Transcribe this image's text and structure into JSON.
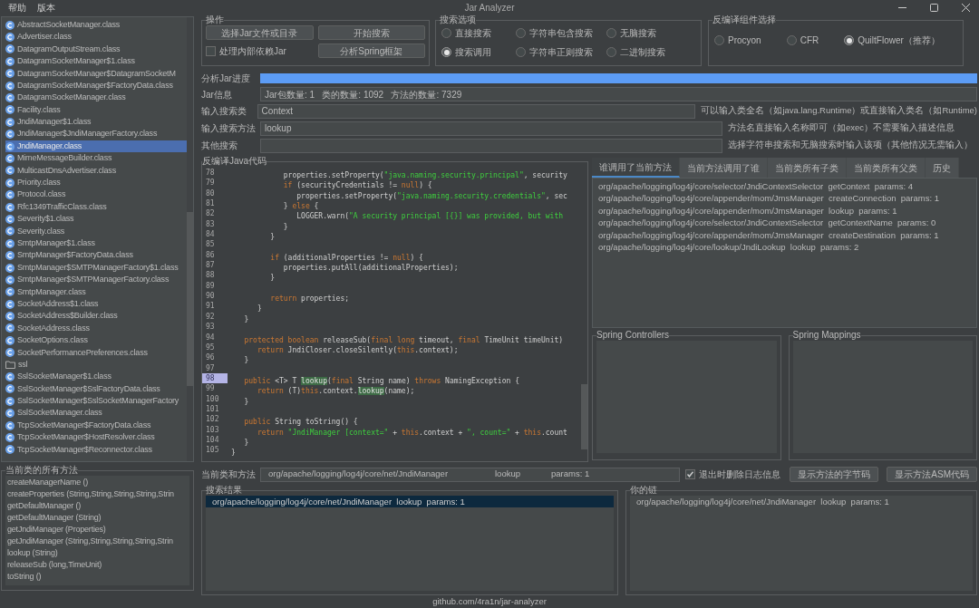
{
  "window": {
    "title": "Jar Analyzer",
    "menu": [
      "帮助",
      "版本"
    ]
  },
  "tree": {
    "items": [
      {
        "label": "AbstractSocketManager.class",
        "kind": "class",
        "selected": false
      },
      {
        "label": "Advertiser.class",
        "kind": "class",
        "selected": false
      },
      {
        "label": "DatagramOutputStream.class",
        "kind": "class",
        "selected": false
      },
      {
        "label": "DatagramSocketManager$1.class",
        "kind": "class",
        "selected": false
      },
      {
        "label": "DatagramSocketManager$DatagramSocketM",
        "kind": "class",
        "selected": false
      },
      {
        "label": "DatagramSocketManager$FactoryData.class",
        "kind": "class",
        "selected": false
      },
      {
        "label": "DatagramSocketManager.class",
        "kind": "class",
        "selected": false
      },
      {
        "label": "Facility.class",
        "kind": "class",
        "selected": false
      },
      {
        "label": "JndiManager$1.class",
        "kind": "class",
        "selected": false
      },
      {
        "label": "JndiManager$JndiManagerFactory.class",
        "kind": "class",
        "selected": false
      },
      {
        "label": "JndiManager.class",
        "kind": "class",
        "selected": true
      },
      {
        "label": "MimeMessageBuilder.class",
        "kind": "class",
        "selected": false
      },
      {
        "label": "MulticastDnsAdvertiser.class",
        "kind": "class",
        "selected": false
      },
      {
        "label": "Priority.class",
        "kind": "class",
        "selected": false
      },
      {
        "label": "Protocol.class",
        "kind": "class",
        "selected": false
      },
      {
        "label": "Rfc1349TrafficClass.class",
        "kind": "class",
        "selected": false
      },
      {
        "label": "Severity$1.class",
        "kind": "class",
        "selected": false
      },
      {
        "label": "Severity.class",
        "kind": "class",
        "selected": false
      },
      {
        "label": "SmtpManager$1.class",
        "kind": "class",
        "selected": false
      },
      {
        "label": "SmtpManager$FactoryData.class",
        "kind": "class",
        "selected": false
      },
      {
        "label": "SmtpManager$SMTPManagerFactory$1.class",
        "kind": "class",
        "selected": false
      },
      {
        "label": "SmtpManager$SMTPManagerFactory.class",
        "kind": "class",
        "selected": false
      },
      {
        "label": "SmtpManager.class",
        "kind": "class",
        "selected": false
      },
      {
        "label": "SocketAddress$1.class",
        "kind": "class",
        "selected": false
      },
      {
        "label": "SocketAddress$Builder.class",
        "kind": "class",
        "selected": false
      },
      {
        "label": "SocketAddress.class",
        "kind": "class",
        "selected": false
      },
      {
        "label": "SocketOptions.class",
        "kind": "class",
        "selected": false
      },
      {
        "label": "SocketPerformancePreferences.class",
        "kind": "class",
        "selected": false
      },
      {
        "label": "ssl",
        "kind": "folder",
        "selected": false
      },
      {
        "label": "SslSocketManager$1.class",
        "kind": "class",
        "selected": false
      },
      {
        "label": "SslSocketManager$SslFactoryData.class",
        "kind": "class",
        "selected": false
      },
      {
        "label": "SslSocketManager$SslSocketManagerFactory",
        "kind": "class",
        "selected": false
      },
      {
        "label": "SslSocketManager.class",
        "kind": "class",
        "selected": false
      },
      {
        "label": "TcpSocketManager$FactoryData.class",
        "kind": "class",
        "selected": false
      },
      {
        "label": "TcpSocketManager$HostResolver.class",
        "kind": "class",
        "selected": false
      },
      {
        "label": "TcpSocketManager$Reconnector.class",
        "kind": "class",
        "selected": false
      }
    ]
  },
  "methods": {
    "title": "当前类的所有方法",
    "items": [
      "createManagerName ()",
      "createProperties (String,String,String,String,Strin",
      "getDefaultManager ()",
      "getDefaultManager (String)",
      "getJndiManager (Properties)",
      "getJndiManager (String,String,String,String,Strin",
      "lookup (String)",
      "releaseSub (long,TimeUnit)",
      "toString ()"
    ]
  },
  "operations": {
    "title": "操作",
    "buttons": [
      "选择Jar文件或目录",
      "开始搜索",
      "分析Spring框架"
    ],
    "checkbox": {
      "label": "处理内部依赖Jar",
      "checked": false
    }
  },
  "search_options": {
    "title": "搜索选项",
    "options": [
      {
        "label": "直接搜索",
        "selected": false
      },
      {
        "label": "字符串包含搜索",
        "selected": false
      },
      {
        "label": "无脑搜索",
        "selected": false
      },
      {
        "label": "搜索调用",
        "selected": true
      },
      {
        "label": "字符串正则搜索",
        "selected": false
      },
      {
        "label": "二进制搜索",
        "selected": false
      }
    ]
  },
  "decompiler": {
    "title": "反编译组件选择",
    "options": [
      {
        "label": "Procyon",
        "selected": false
      },
      {
        "label": "CFR",
        "selected": false
      },
      {
        "label": "QuiltFlower（推荐）",
        "selected": true
      }
    ]
  },
  "progress": {
    "label": "分析Jar进度",
    "level": 1
  },
  "jar_info": {
    "label": "Jar信息",
    "value": "Jar包数量: 1   类的数量: 1092   方法的数量: 7329"
  },
  "inputs": [
    {
      "label": "输入搜索类",
      "value": "Context",
      "hint": "可以输入类全名（如java.lang.Runtime）或直接输入类名（如Runtime)"
    },
    {
      "label": "输入搜索方法",
      "value": "lookup",
      "hint": "方法名直接输入名称即可（如exec）不需要输入描述信息"
    },
    {
      "label": "其他搜索",
      "hint": "选择字符串搜索和无脑搜索时输入该项（其他情况无需输入）"
    }
  ],
  "code": {
    "title": "反编译Java代码",
    "lines": [
      {
        "number": "78",
        "selected": false,
        "tokens": [
          {
            "kind": "plain",
            "text": "            properties.setProperty("
          },
          {
            "kind": "string",
            "text": "\"java.naming.security.principal\""
          },
          {
            "kind": "plain",
            "text": ", security"
          }
        ]
      },
      {
        "number": "79",
        "selected": false,
        "tokens": [
          {
            "kind": "keyword",
            "text": "            if"
          },
          {
            "kind": "plain",
            "text": " (securityCredentials != "
          },
          {
            "kind": "keyword",
            "text": "null"
          },
          {
            "kind": "plain",
            "text": ") {"
          }
        ]
      },
      {
        "number": "80",
        "selected": false,
        "tokens": [
          {
            "kind": "plain",
            "text": "               properties.setProperty("
          },
          {
            "kind": "string",
            "text": "\"java.naming.security.credentials\""
          },
          {
            "kind": "plain",
            "text": ", sec"
          }
        ]
      },
      {
        "number": "81",
        "selected": false,
        "tokens": [
          {
            "kind": "plain",
            "text": "            } "
          },
          {
            "kind": "keyword",
            "text": "else"
          },
          {
            "kind": "plain",
            "text": " {"
          }
        ]
      },
      {
        "number": "82",
        "selected": false,
        "tokens": [
          {
            "kind": "plain",
            "text": "               LOGGER.warn("
          },
          {
            "kind": "string",
            "text": "\"A security principal [{}] was provided, but with"
          }
        ]
      },
      {
        "number": "83",
        "selected": false,
        "tokens": [
          {
            "kind": "plain",
            "text": "            }"
          }
        ]
      },
      {
        "number": "84",
        "selected": false,
        "tokens": [
          {
            "kind": "plain",
            "text": "         }"
          }
        ]
      },
      {
        "number": "85",
        "selected": false
      },
      {
        "number": "86",
        "selected": false,
        "tokens": [
          {
            "kind": "keyword",
            "text": "         if"
          },
          {
            "kind": "plain",
            "text": " (additionalProperties != "
          },
          {
            "kind": "keyword",
            "text": "null"
          },
          {
            "kind": "plain",
            "text": ") {"
          }
        ]
      },
      {
        "number": "87",
        "selected": false,
        "tokens": [
          {
            "kind": "plain",
            "text": "            properties.putAll(additionalProperties);"
          }
        ]
      },
      {
        "number": "88",
        "selected": false,
        "tokens": [
          {
            "kind": "plain",
            "text": "         }"
          }
        ]
      },
      {
        "number": "89",
        "selected": false
      },
      {
        "number": "90",
        "selected": false,
        "tokens": [
          {
            "kind": "keyword",
            "text": "         return"
          },
          {
            "kind": "plain",
            "text": " properties;"
          }
        ]
      },
      {
        "number": "91",
        "selected": false,
        "tokens": [
          {
            "kind": "plain",
            "text": "      }"
          }
        ]
      },
      {
        "number": "92",
        "selected": false,
        "tokens": [
          {
            "kind": "plain",
            "text": "   }"
          }
        ]
      },
      {
        "number": "93",
        "selected": false
      },
      {
        "number": "94",
        "selected": false,
        "tokens": [
          {
            "kind": "keyword",
            "text": "   protected boolean"
          },
          {
            "kind": "plain",
            "text": " releaseSub("
          },
          {
            "kind": "keyword",
            "text": "final long"
          },
          {
            "kind": "plain",
            "text": " timeout, "
          },
          {
            "kind": "keyword",
            "text": "final"
          },
          {
            "kind": "plain",
            "text": " TimeUnit timeUnit)"
          }
        ]
      },
      {
        "number": "95",
        "selected": false,
        "tokens": [
          {
            "kind": "keyword",
            "text": "      return"
          },
          {
            "kind": "plain",
            "text": " JndiCloser.closeSilently("
          },
          {
            "kind": "keyword",
            "text": "this"
          },
          {
            "kind": "plain",
            "text": ".context);"
          }
        ]
      },
      {
        "number": "96",
        "selected": false,
        "tokens": [
          {
            "kind": "plain",
            "text": "   }"
          }
        ]
      },
      {
        "number": "97",
        "selected": false
      },
      {
        "number": "98",
        "selected": true,
        "tokens": [
          {
            "kind": "keyword",
            "text": "   public"
          },
          {
            "kind": "plain",
            "text": " <T> T "
          },
          {
            "kind": "match",
            "text": "lookup"
          },
          {
            "kind": "plain",
            "text": "("
          },
          {
            "kind": "keyword",
            "text": "final"
          },
          {
            "kind": "plain",
            "text": " String name) "
          },
          {
            "kind": "keyword",
            "text": "throws"
          },
          {
            "kind": "plain",
            "text": " NamingException {"
          }
        ]
      },
      {
        "number": "99",
        "selected": false,
        "tokens": [
          {
            "kind": "keyword",
            "text": "      return"
          },
          {
            "kind": "plain",
            "text": " (T)"
          },
          {
            "kind": "keyword",
            "text": "this"
          },
          {
            "kind": "plain",
            "text": ".context."
          },
          {
            "kind": "match",
            "text": "lookup"
          },
          {
            "kind": "plain",
            "text": "(name);"
          }
        ]
      },
      {
        "number": "100",
        "selected": false,
        "tokens": [
          {
            "kind": "plain",
            "text": "   }"
          }
        ]
      },
      {
        "number": "101",
        "selected": false
      },
      {
        "number": "102",
        "selected": false,
        "tokens": [
          {
            "kind": "keyword",
            "text": "   public"
          },
          {
            "kind": "plain",
            "text": " String toString() {"
          }
        ]
      },
      {
        "number": "103",
        "selected": false,
        "tokens": [
          {
            "kind": "keyword",
            "text": "      return"
          },
          {
            "kind": "string",
            "text": " \"JndiManager [context=\""
          },
          {
            "kind": "plain",
            "text": " + "
          },
          {
            "kind": "keyword",
            "text": "this"
          },
          {
            "kind": "plain",
            "text": ".context + "
          },
          {
            "kind": "string",
            "text": "\", count=\""
          },
          {
            "kind": "plain",
            "text": " + "
          },
          {
            "kind": "keyword",
            "text": "this"
          },
          {
            "kind": "plain",
            "text": ".count"
          }
        ]
      },
      {
        "number": "104",
        "selected": false,
        "tokens": [
          {
            "kind": "plain",
            "text": "   }"
          }
        ]
      },
      {
        "number": "105",
        "selected": false,
        "tokens": [
          {
            "kind": "plain",
            "text": "}"
          }
        ]
      }
    ]
  },
  "tabs": [
    {
      "label": "谁调用了当前方法",
      "selected": true
    },
    {
      "label": "当前方法调用了谁",
      "selected": false
    },
    {
      "label": "当前类所有子类",
      "selected": false
    },
    {
      "label": "当前类所有父类",
      "selected": false
    },
    {
      "label": "历史",
      "selected": false
    }
  ],
  "callers": [
    "org/apache/logging/log4j/core/selector/JndiContextSelector  getContext  params: 4",
    "org/apache/logging/log4j/core/appender/mom/JmsManager  createConnection  params: 1",
    "org/apache/logging/log4j/core/appender/mom/JmsManager  lookup  params: 1",
    "org/apache/logging/log4j/core/selector/JndiContextSelector  getContextName  params: 0",
    "org/apache/logging/log4j/core/appender/mom/JmsManager  createDestination  params: 1",
    "org/apache/logging/log4j/core/lookup/JndiLookup  lookup  params: 2"
  ],
  "spring": [
    {
      "title": "Spring Controllers"
    },
    {
      "title": "Spring Mappings"
    }
  ],
  "current": {
    "label": "当前类和方法",
    "class": "org/apache/logging/log4j/core/net/JndiManager",
    "method": "lookup",
    "params": "params: 1",
    "checkbox": {
      "label": "退出时删除日志信息",
      "checked": true
    },
    "buttons": [
      "显示方法的字节码",
      "显示方法ASM代码"
    ]
  },
  "results": {
    "title": "搜索结果",
    "rows": [
      {
        "text": "org/apache/logging/log4j/core/net/JndiManager  lookup  params: 1",
        "selected": true
      }
    ]
  },
  "chain": {
    "title": "你的链",
    "rows": [
      "org/apache/logging/log4j/core/net/JndiManager  lookup  params: 1"
    ]
  },
  "footer": "github.com/4ra1n/jar-analyzer"
}
